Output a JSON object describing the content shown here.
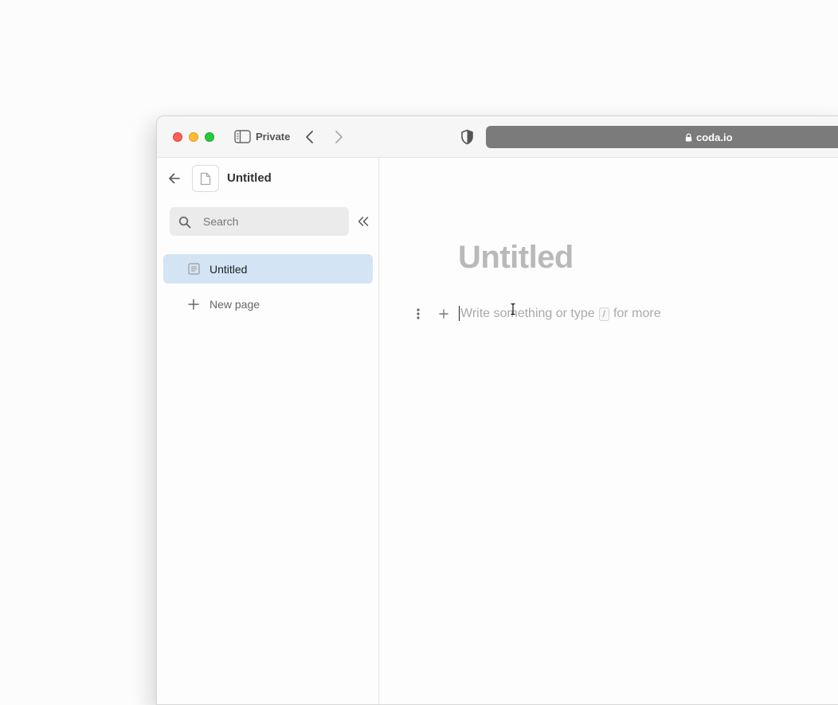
{
  "browser": {
    "window_label": "Private",
    "url": "coda.io",
    "icons": {
      "sidebar_toggle": "sidebar-toggle-icon",
      "back": "chevron-left-icon",
      "forward": "chevron-right-icon",
      "privacy": "shield-icon",
      "lock": "lock-icon"
    },
    "traffic_lights": [
      "#fe5f57",
      "#febc2e",
      "#28c840"
    ]
  },
  "sidebar": {
    "doc_title": "Untitled",
    "search_placeholder": "Search",
    "pages": [
      {
        "label": "Untitled",
        "selected": true
      }
    ],
    "new_page_label": "New page",
    "selected_color": "#d3e5f5"
  },
  "editor": {
    "page_title": "Untitled",
    "placeholder_before": "Write something or type",
    "slash_key": "/",
    "placeholder_after": "for more"
  }
}
